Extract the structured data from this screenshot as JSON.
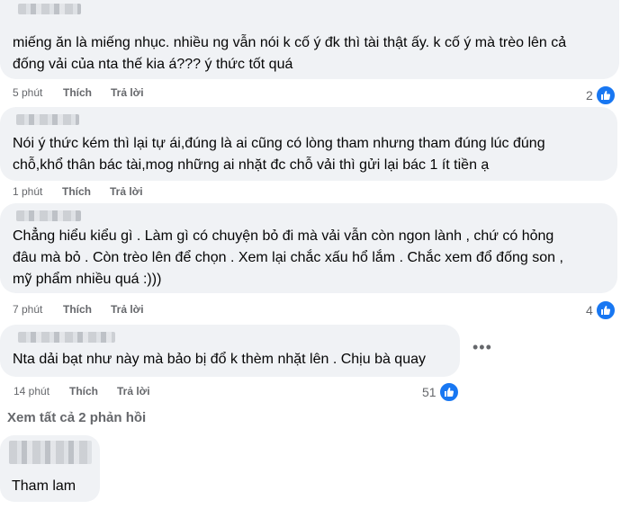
{
  "comments": [
    {
      "lines": [
        "miếng ăn là miếng nhục. nhiều ng vẫn nói k cố ý đk thì tài thật ấy. k cố ý mà trèo lên cả",
        "đống vải của nta thế kia á??? ý thức tốt quá"
      ],
      "time": "5 phút",
      "like": "Thích",
      "reply": "Trả lời",
      "reactions": "2"
    },
    {
      "lines": [
        "Nói ý thức kém thì lại tự ái,đúng là ai cũng có lòng tham nhưng tham đúng lúc đúng",
        "chỗ,khổ thân bác tài,mog những ai nhặt đc chỗ vải thì gửi lại bác 1 ít tiền ạ"
      ],
      "time": "1 phút",
      "like": "Thích",
      "reply": "Trả lời",
      "reactions": ""
    },
    {
      "lines": [
        "Chẳng hiểu kiểu gì . Làm gì có chuyện bỏ đi mà vải vẫn còn ngon lành , chứ có hỏng",
        "đâu mà bỏ . Còn trèo lên để chọn . Xem lại chắc xấu hổ lắm . Chắc xem đổ đống son ,",
        "mỹ phẩm nhiều quá :)))"
      ],
      "time": "7 phút",
      "like": "Thích",
      "reply": "Trả lời",
      "reactions": "4"
    },
    {
      "lines": [
        "Nta dải bạt như này mà bảo bị đổ k thèm nhặt lên . Chịu bà quay"
      ],
      "time": "14 phút",
      "like": "Thích",
      "reply": "Trả lời",
      "reactions": "51"
    }
  ],
  "view_all": "Xem tất cả 2 phản hồi",
  "last_comment": {
    "text": "Tham lam"
  },
  "icons": {
    "like": "like-thumb-icon",
    "more": "more-options-icon"
  },
  "colors": {
    "like_badge": "#1877f2",
    "bubble": "#f0f2f5",
    "meta": "#65676b"
  }
}
